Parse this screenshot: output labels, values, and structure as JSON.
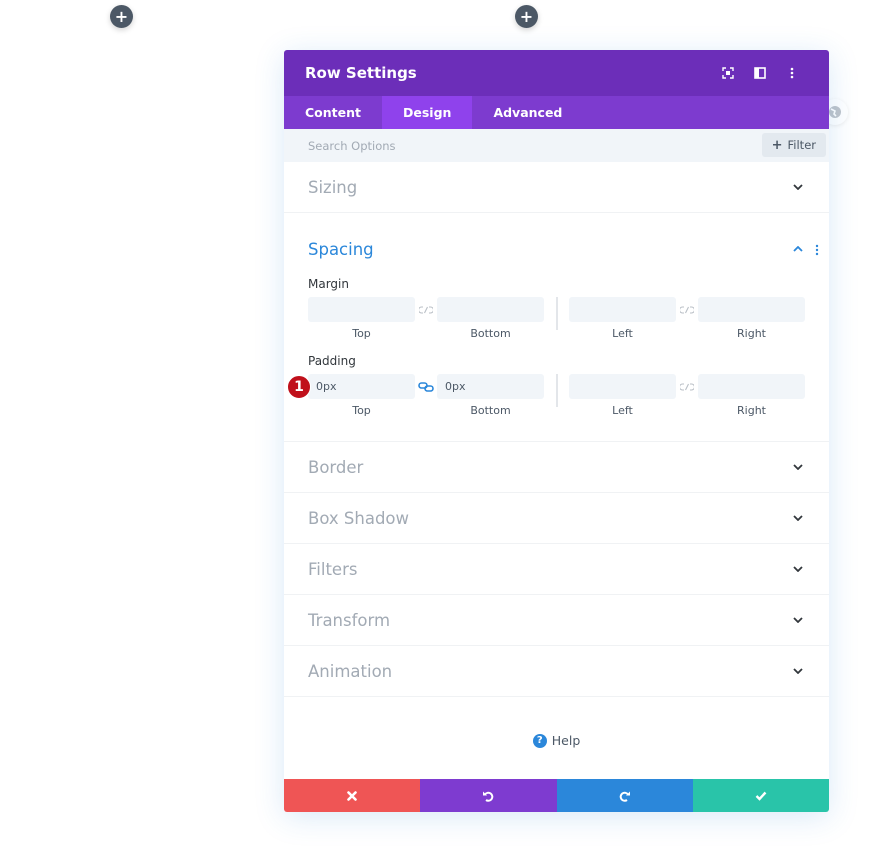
{
  "canvas": {
    "add_buttons": [
      {
        "icon": "plus-icon",
        "label": "+"
      },
      {
        "icon": "plus-icon",
        "label": "+"
      }
    ]
  },
  "modal": {
    "title": "Row Settings",
    "header_icons": [
      "fullscreen-icon",
      "split-view-icon",
      "more-options-icon"
    ],
    "tabs": [
      {
        "label": "Content",
        "active": false
      },
      {
        "label": "Design",
        "active": true
      },
      {
        "label": "Advanced",
        "active": false
      }
    ],
    "search": {
      "placeholder": "Search Options",
      "value": ""
    },
    "filter": {
      "label": "Filter",
      "icon": "plus-icon"
    },
    "sections": {
      "sizing": {
        "title": "Sizing",
        "expanded": false
      },
      "spacing": {
        "title": "Spacing",
        "expanded": true,
        "margin": {
          "label": "Margin",
          "fields": [
            {
              "caption": "Top",
              "value": ""
            },
            {
              "caption": "Bottom",
              "value": ""
            },
            {
              "caption": "Left",
              "value": ""
            },
            {
              "caption": "Right",
              "value": ""
            }
          ],
          "linked_vertical": false,
          "linked_horizontal": false
        },
        "padding": {
          "label": "Padding",
          "fields": [
            {
              "caption": "Top",
              "value": "0px"
            },
            {
              "caption": "Bottom",
              "value": "0px"
            },
            {
              "caption": "Left",
              "value": ""
            },
            {
              "caption": "Right",
              "value": ""
            }
          ],
          "linked_vertical": true,
          "linked_horizontal": false
        },
        "step_badge": "1"
      },
      "border": {
        "title": "Border",
        "expanded": false
      },
      "box_shadow": {
        "title": "Box Shadow",
        "expanded": false
      },
      "filters": {
        "title": "Filters",
        "expanded": false
      },
      "transform": {
        "title": "Transform",
        "expanded": false
      },
      "animation": {
        "title": "Animation",
        "expanded": false
      }
    },
    "help": {
      "label": "Help",
      "icon": "?"
    },
    "footer": {
      "cancel": "cancel-icon",
      "undo": "undo-icon",
      "redo": "redo-icon",
      "save": "save-check-icon"
    }
  },
  "colors": {
    "header": "#6c2eb9",
    "tabs": "#7d3bcf",
    "active_tab": "#8f42ec",
    "accent_blue": "#2b87da",
    "cancel": "#ef5555",
    "undo": "#7e3bd0",
    "redo": "#2b87da",
    "save": "#29c4a9",
    "badge": "#c0101b"
  }
}
